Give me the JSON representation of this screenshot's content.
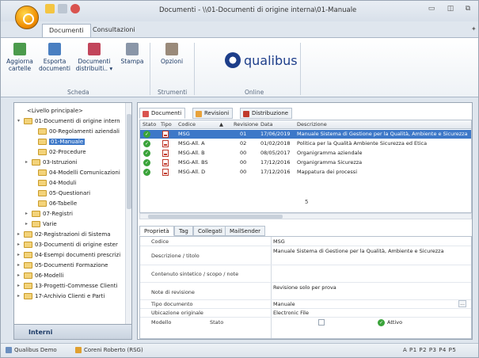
{
  "window": {
    "title": "Documenti - \\\\01-Documenti di origine interna\\01-Manuale"
  },
  "ribbon_tabs": [
    {
      "label": "Documenti"
    },
    {
      "label": "Consultazioni"
    }
  ],
  "ribbon": {
    "scheda": {
      "label": "Scheda",
      "buttons": [
        {
          "line1": "Aggiorna",
          "line2": "cartelle"
        },
        {
          "line1": "Esporta",
          "line2": "documenti"
        },
        {
          "line1": "Documenti",
          "line2": "distribuiti.. ▾"
        },
        {
          "line1": "Stampa",
          "line2": ""
        }
      ]
    },
    "strumenti": {
      "label": "Strumenti",
      "button": {
        "line1": "Opzioni"
      }
    },
    "online": {
      "label": "Online",
      "logo_text": "qualibus"
    }
  },
  "tree": {
    "items": [
      {
        "label": "<Livello principale>",
        "expander": ""
      },
      {
        "label": "01-Documenti di origine intern",
        "expander": "▾"
      },
      {
        "label": "00-Regolamenti aziendali",
        "expander": ""
      },
      {
        "label": "01-Manuale",
        "expander": ""
      },
      {
        "label": "02-Procedure",
        "expander": ""
      },
      {
        "label": "03-Istruzioni",
        "expander": "▸"
      },
      {
        "label": "04-Modelli Comunicazioni",
        "expander": ""
      },
      {
        "label": "04-Moduli",
        "expander": ""
      },
      {
        "label": "05-Questionari",
        "expander": ""
      },
      {
        "label": "06-Tabelle",
        "expander": ""
      },
      {
        "label": "07-Registri",
        "expander": "▸"
      },
      {
        "label": "Varie",
        "expander": "▸"
      },
      {
        "label": "02-Registrazioni di Sistema",
        "expander": "▸"
      },
      {
        "label": "03-Documenti di origine ester",
        "expander": "▸"
      },
      {
        "label": "04-Esempi documenti prescrizi",
        "expander": "▸"
      },
      {
        "label": "05-Documenti Formazione",
        "expander": "▸"
      },
      {
        "label": "06-Modelli",
        "expander": "▸"
      },
      {
        "label": "13-Progetti-Commesse Clienti",
        "expander": "▸"
      },
      {
        "label": "17-Archivio Clienti e Parti",
        "expander": "▸"
      }
    ],
    "footer_label": "Interni"
  },
  "doc_tabs": [
    {
      "label": "Documenti",
      "color": "#d9534f"
    },
    {
      "label": "Revisioni",
      "color": "#e8a23a"
    },
    {
      "label": "Distribuzione",
      "color": "#c0392b"
    }
  ],
  "grid": {
    "headers": {
      "stato": "Stato",
      "tipo": "Tipo",
      "codice": "Codice",
      "sort": "▲",
      "revisione": "Revisione",
      "data": "Data",
      "descrizione": "Descrizione"
    },
    "rows": [
      {
        "codice": "MSG",
        "revisione": "01",
        "data": "17/06/2019",
        "descrizione": "Manuale Sistema di Gestione per la Qualità, Ambiente e Sicurezza"
      },
      {
        "codice": "MSG-All. A",
        "revisione": "02",
        "data": "01/02/2018",
        "descrizione": "Politica per la Qualità Ambiente Sicurezza ed Etica"
      },
      {
        "codice": "MSG-All. B",
        "revisione": "00",
        "data": "08/05/2017",
        "descrizione": "Organigramma aziendale"
      },
      {
        "codice": "MSG-All. BS",
        "revisione": "00",
        "data": "17/12/2016",
        "descrizione": "Organigramma Sicurezza"
      },
      {
        "codice": "MSG-All. D",
        "revisione": "00",
        "data": "17/12/2016",
        "descrizione": "Mappatura dei processi"
      }
    ],
    "count": "5"
  },
  "prop_tabs": [
    {
      "label": "Proprietà"
    },
    {
      "label": "Tag"
    },
    {
      "label": "Collegati"
    },
    {
      "label": "MailSender"
    }
  ],
  "properties": {
    "codice": {
      "label": "Codice",
      "value": "MSG"
    },
    "descrizione": {
      "label": "Descrizione / titolo",
      "value": "Manuale Sistema di Gestione per la Qualità, Ambiente e Sicurezza"
    },
    "contenuto": {
      "label": "Contenuto sintetico / scopo / note",
      "value": ""
    },
    "note_revisione": {
      "label": "Note di revisione",
      "value": "Revisione solo per prova"
    },
    "tipo_documento": {
      "label": "Tipo documento",
      "value": "Manuale",
      "button": "..."
    },
    "ubicazione": {
      "label": "Ubicazione originale",
      "value": "Electronic File"
    },
    "modello": {
      "label": "Modello"
    },
    "stato": {
      "label": "Stato",
      "value": "Attivo"
    }
  },
  "statusbar": {
    "left1": "Qualibus Demo",
    "left2": "Coreni Roberto (RSG)",
    "right": "A  P1  P2  P3  P4  P5"
  },
  "colors": {
    "selection": "#3d78c8",
    "active_green": "#3aa33a",
    "brand": "#1d3e8a"
  }
}
